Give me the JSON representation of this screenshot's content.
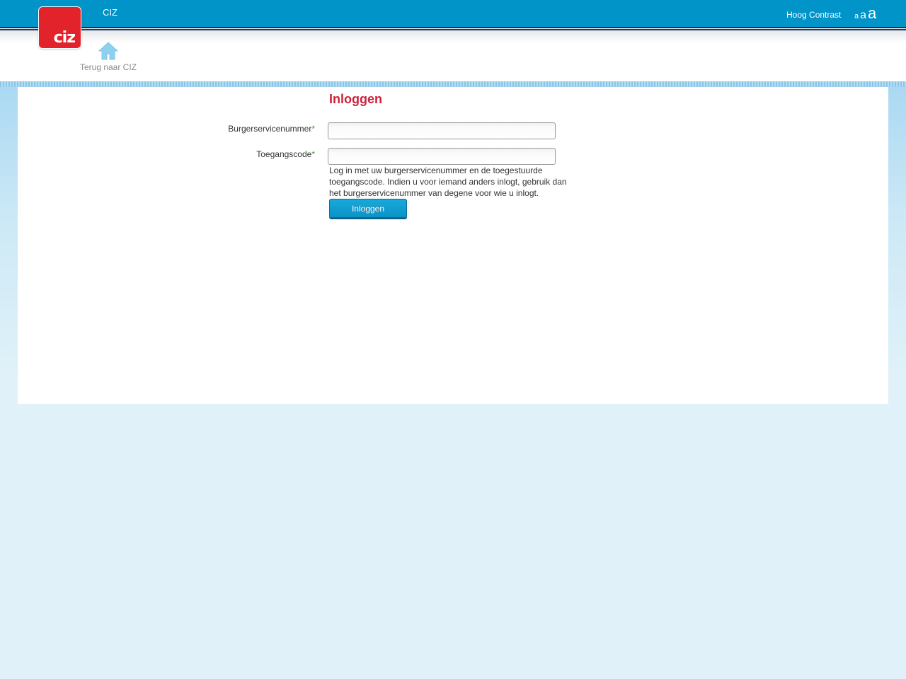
{
  "header": {
    "brand": "CIZ",
    "logo_text": "ciz",
    "high_contrast_label": "Hoog Contrast",
    "font_size_small": "a",
    "font_size_medium": "a",
    "font_size_large": "a",
    "home_link_label": "Terug naar CIZ",
    "home_icon": "home-icon",
    "brand_color": "#0094c9",
    "logo_color": "#e3232b"
  },
  "login": {
    "title": "Inloggen",
    "bsn_label": "Burgerservicenummer",
    "code_label": "Toegangscode",
    "required_marker": "*",
    "bsn_value": "",
    "code_value": "",
    "help_text": "Log in met uw burgerservicenummer en de toegestuurde toegangscode. Indien u voor iemand anders inlogt, gebruik dan het burgerservicenummer van degene voor wie u inlogt.",
    "submit_label": "Inloggen",
    "title_color": "#d1213a",
    "required_color": "#3b9c2a"
  }
}
